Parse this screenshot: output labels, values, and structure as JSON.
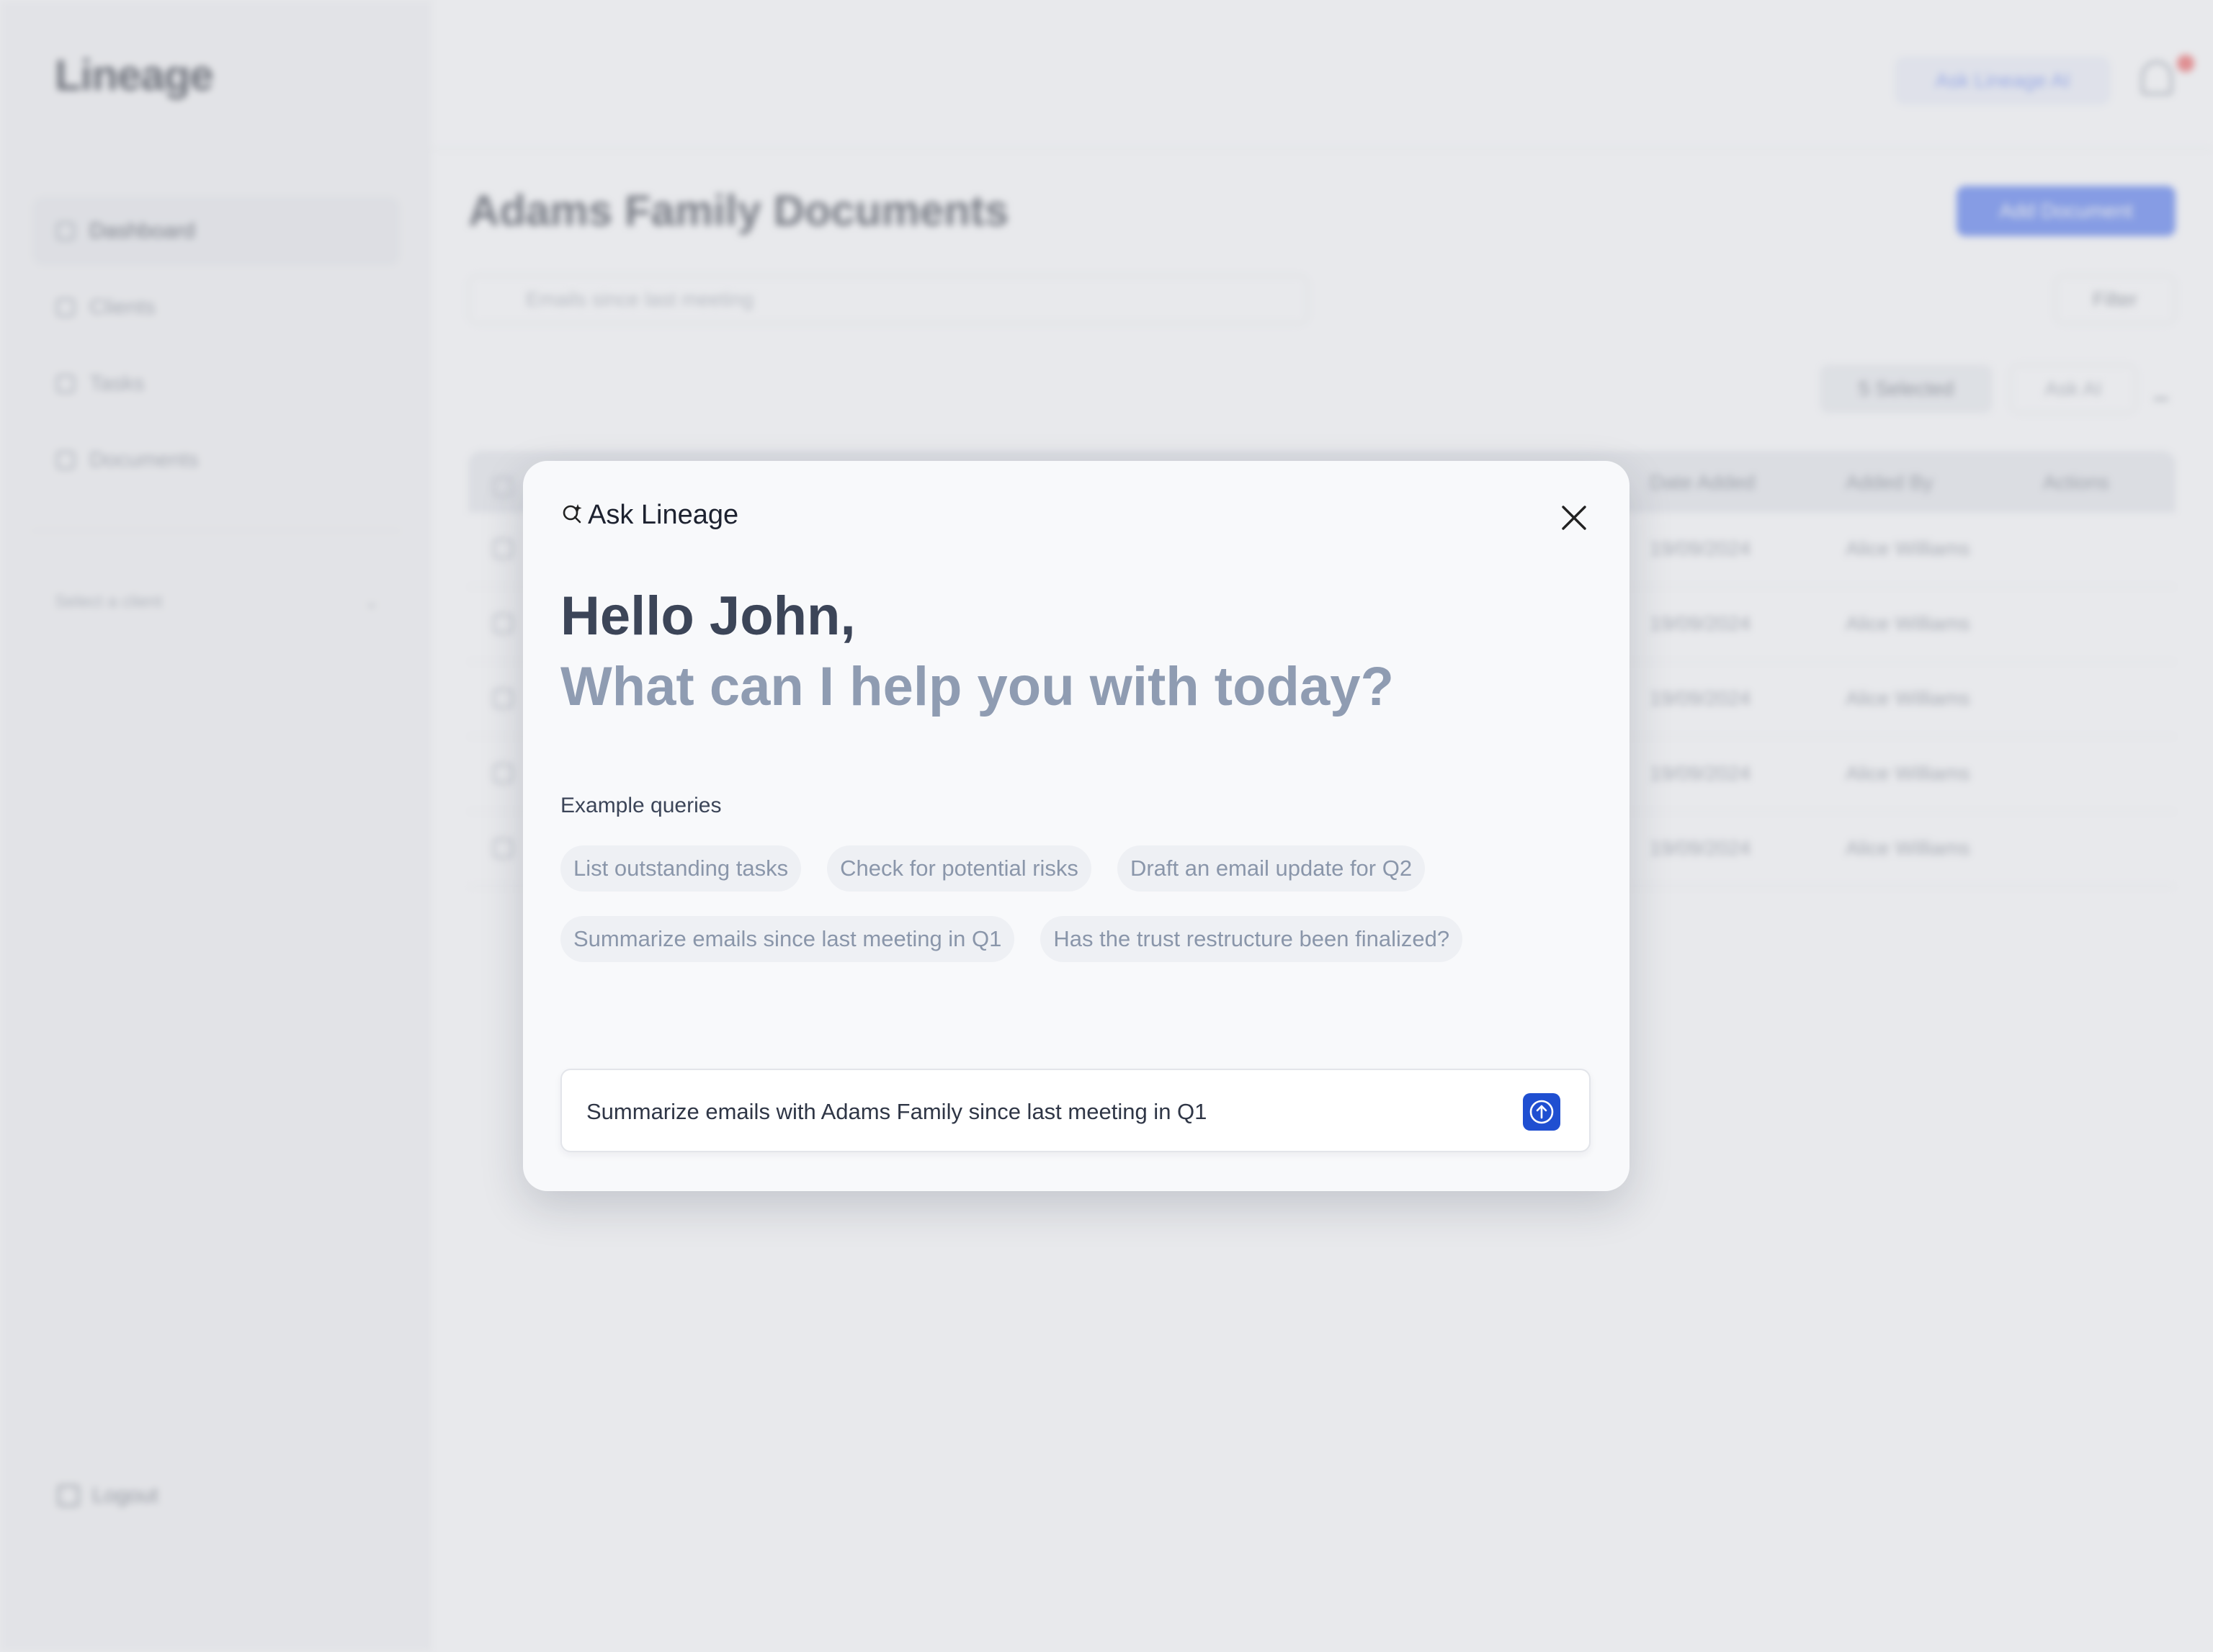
{
  "app": {
    "brand": "Lineage",
    "nav": [
      {
        "label": "Dashboard",
        "active": true
      },
      {
        "label": "Clients",
        "active": false
      },
      {
        "label": "Tasks",
        "active": false
      },
      {
        "label": "Documents",
        "active": false
      }
    ],
    "client_select": "Select a client",
    "logout": "Logout",
    "ask_ai_top": "Ask Lineage AI",
    "page_title": "Adams Family Documents",
    "add_document": "Add Document",
    "search_placeholder": "Emails since last meeting",
    "filter": "Filter",
    "selected": "5 Selected",
    "ask_ai": "Ask AI",
    "table": {
      "headers": [
        "Date Added",
        "Added By",
        "Actions"
      ],
      "rows": [
        {
          "date": "19/09/2024",
          "by": "Alice Williams"
        },
        {
          "date": "19/09/2024",
          "by": "Alice Williams"
        },
        {
          "date": "19/09/2024",
          "by": "Alice Williams"
        },
        {
          "date": "19/09/2024",
          "by": "Alice Williams"
        },
        {
          "date": "19/09/2024",
          "by": "Alice Williams"
        }
      ]
    }
  },
  "modal": {
    "title": "Ask Lineage",
    "greeting": "Hello John,",
    "prompt": "What can I help you with today?",
    "examples_label": "Example queries",
    "examples": [
      "List outstanding tasks",
      "Check for potential risks",
      "Draft an email update for Q2",
      "Summarize emails since last meeting in Q1",
      "Has the trust restructure been finalized?"
    ],
    "input_value": "Summarize emails with Adams Family since last meeting in Q1"
  },
  "colors": {
    "accent": "#1f4fd1",
    "chip_bg": "#eef0f4",
    "greeting": "#3c4558",
    "prompt": "#8f9cb2"
  }
}
